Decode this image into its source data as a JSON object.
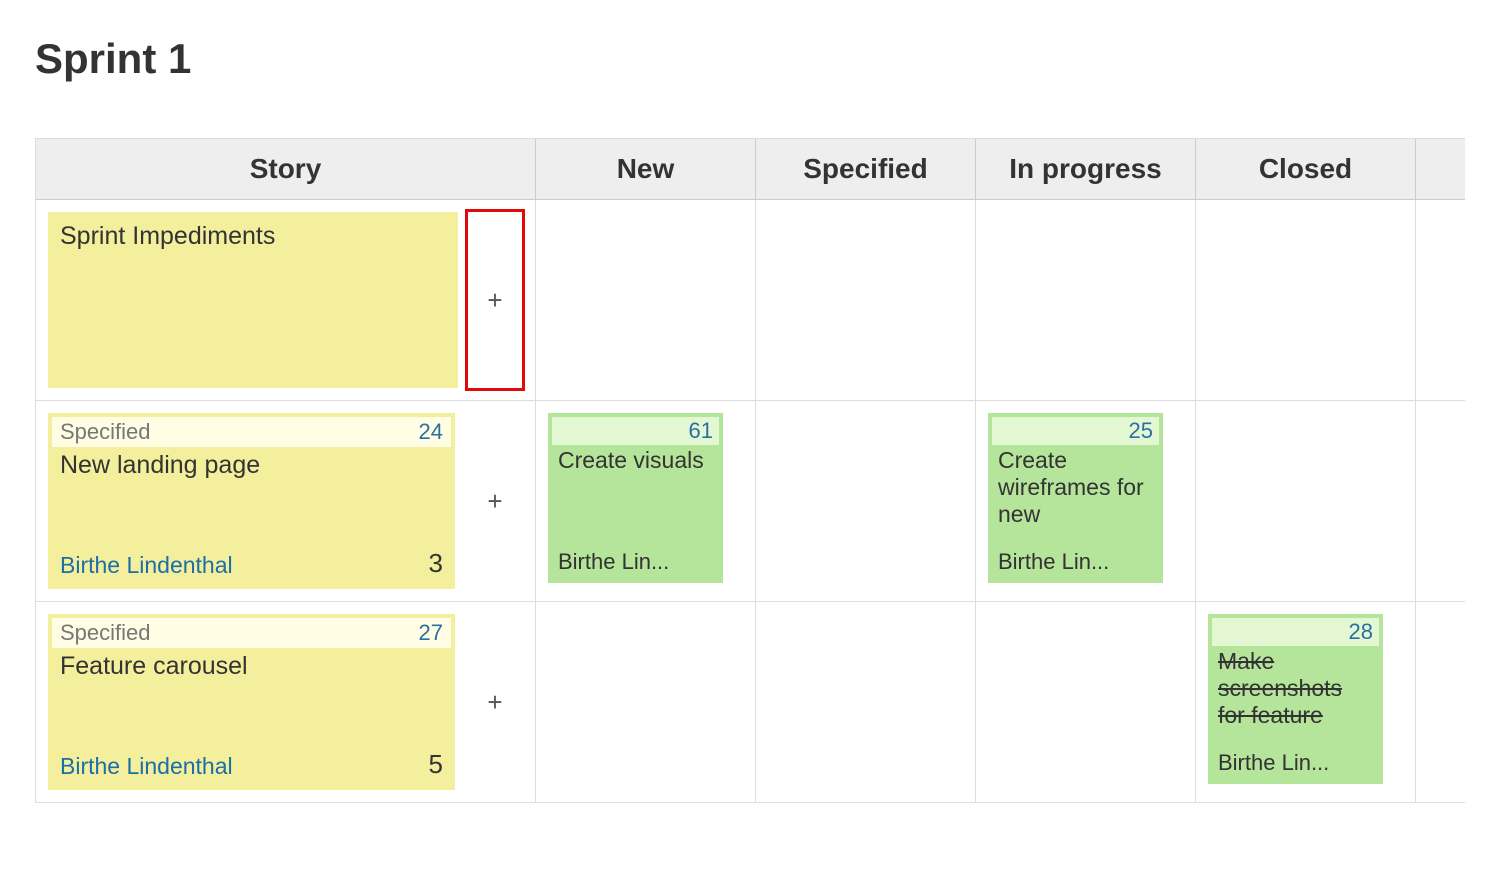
{
  "title": "Sprint 1",
  "columns": {
    "story": "Story",
    "new": "New",
    "specified": "Specified",
    "in_progress": "In progress",
    "closed": "Closed"
  },
  "rows": [
    {
      "story": {
        "title": "Sprint Impediments",
        "status": null,
        "id": null,
        "assignee": null,
        "points": null
      },
      "add_highlighted": true,
      "tasks": {
        "new": null,
        "specified": null,
        "in_progress": null,
        "closed": null
      }
    },
    {
      "story": {
        "title": "New landing page",
        "status": "Specified",
        "id": "24",
        "assignee": "Birthe Lindenthal",
        "points": "3"
      },
      "add_highlighted": false,
      "tasks": {
        "new": {
          "id": "61",
          "title": "Create visuals",
          "assignee": "Birthe Lin...",
          "strike": false
        },
        "specified": null,
        "in_progress": {
          "id": "25",
          "title": "Create wireframes for new",
          "assignee": "Birthe Lin...",
          "strike": false
        },
        "closed": null
      }
    },
    {
      "story": {
        "title": "Feature carousel",
        "status": "Specified",
        "id": "27",
        "assignee": "Birthe Lindenthal",
        "points": "5"
      },
      "add_highlighted": false,
      "tasks": {
        "new": null,
        "specified": null,
        "in_progress": null,
        "closed": {
          "id": "28",
          "title": "Make screenshots for feature",
          "assignee": "Birthe Lin...",
          "strike": true
        }
      }
    }
  ]
}
